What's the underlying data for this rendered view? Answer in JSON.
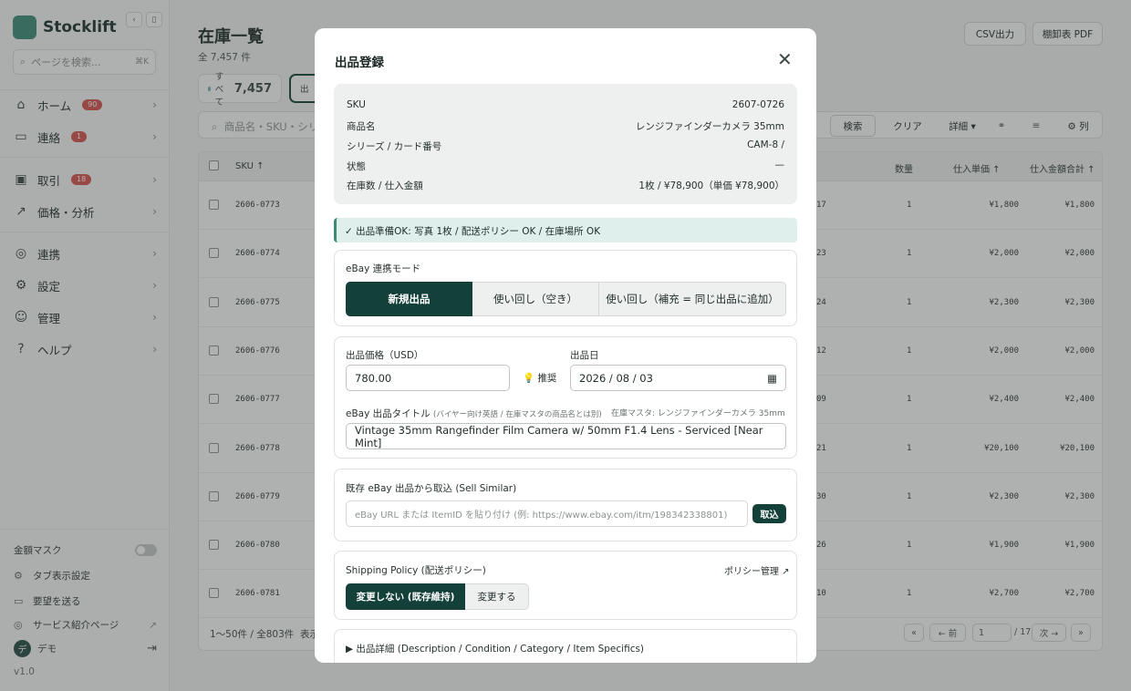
{
  "app": {
    "name": "Stocklift",
    "version": "v1.0"
  },
  "sidebar": {
    "search_placeholder": "ページを検索...",
    "search_shortcut": "⌘K",
    "items": [
      {
        "label": "ホーム",
        "badge": "90",
        "icon": "home-icon"
      },
      {
        "label": "連絡",
        "badge": "1",
        "icon": "chat-icon"
      },
      {
        "label": "取引",
        "badge": "18",
        "icon": "briefcase-icon"
      },
      {
        "label": "価格・分析",
        "badge": "",
        "icon": "trend-icon"
      },
      {
        "label": "連携",
        "badge": "",
        "icon": "globe-icon"
      },
      {
        "label": "設定",
        "badge": "",
        "icon": "gear-icon"
      },
      {
        "label": "管理",
        "badge": "",
        "icon": "users-icon"
      },
      {
        "label": "ヘルプ",
        "badge": "",
        "icon": "help-icon"
      }
    ],
    "footer": {
      "amount_mask": "金額マスク",
      "tab_settings": "タブ表示設定",
      "feedback": "要望を送る",
      "service_page": "サービス紹介ページ",
      "user": "デモ",
      "user_initial": "デ"
    }
  },
  "page": {
    "title": "在庫一覧",
    "subtitle": "全 7,457 件",
    "csv_button": "CSV出力",
    "inventory_pdf_button": "棚卸表 PDF",
    "chip_all_label": "すべて",
    "chip_all_count": "7,457",
    "chip_second": "出",
    "search_placeholder": "商品名・SKU・シリ",
    "search_button": "検索",
    "clear_button": "クリア",
    "detail_button": "詳細 ▾",
    "columns_button": "⚙ 列",
    "headers": {
      "sku": "SKU ↑",
      "qty": "数量",
      "unit_cost": "仕入単価 ↑",
      "total_cost": "仕入金額合計 ↑"
    },
    "rows": [
      {
        "sku": "2606-0773",
        "mid": "17",
        "qty": "1",
        "unit": "¥1,800",
        "total": "¥1,800"
      },
      {
        "sku": "2606-0774",
        "mid": "23",
        "qty": "1",
        "unit": "¥2,000",
        "total": "¥2,000"
      },
      {
        "sku": "2606-0775",
        "mid": "24",
        "qty": "1",
        "unit": "¥2,300",
        "total": "¥2,300"
      },
      {
        "sku": "2606-0776",
        "mid": "12",
        "qty": "1",
        "unit": "¥2,000",
        "total": "¥2,000"
      },
      {
        "sku": "2606-0777",
        "mid": "09",
        "qty": "1",
        "unit": "¥2,400",
        "total": "¥2,400"
      },
      {
        "sku": "2606-0778",
        "mid": "21",
        "qty": "1",
        "unit": "¥20,100",
        "total": "¥20,100"
      },
      {
        "sku": "2606-0779",
        "mid": "30",
        "qty": "1",
        "unit": "¥2,300",
        "total": "¥2,300"
      },
      {
        "sku": "2606-0780",
        "mid": "26",
        "qty": "1",
        "unit": "¥1,900",
        "total": "¥1,900"
      },
      {
        "sku": "2606-0781",
        "mid": "10",
        "qty": "1",
        "unit": "¥2,700",
        "total": "¥2,700"
      }
    ],
    "pager": {
      "range": "1〜50件 / 全803件",
      "display": "表示",
      "first": "«",
      "prev": "← 前",
      "page": "1",
      "of": "/ 17",
      "next": "次 →",
      "last": "»"
    }
  },
  "modal": {
    "title": "出品登録",
    "info": [
      {
        "label": "SKU",
        "value": "2607-0726"
      },
      {
        "label": "商品名",
        "value": "レンジファインダーカメラ 35mm"
      },
      {
        "label": "シリーズ / カード番号",
        "value": "CAM-8 /"
      },
      {
        "label": "状態",
        "value": "—"
      },
      {
        "label": "在庫数 / 仕入金額",
        "value": "1枚 / ¥78,900（単価 ¥78,900）"
      }
    ],
    "ok_message": "✓ 出品準備OK: 写真 1枚 / 配送ポリシー OK / 在庫場所 OK",
    "mode_label": "eBay 連携モード",
    "mode_options": [
      "新規出品",
      "使い回し（空き）",
      "使い回し（補充 = 同じ出品に追加）"
    ],
    "price_label": "出品価格（USD）",
    "price_value": "780.00",
    "suggest_label": "推奨",
    "date_label": "出品日",
    "date_value": "2026 / 08 / 03",
    "ebay_title_label": "eBay 出品タイトル",
    "ebay_title_note": "(バイヤー向け英語 / 在庫マスタの商品名とは別)",
    "master_note": "在庫マスタ: レンジファインダーカメラ 35mm",
    "ebay_title_value": "Vintage 35mm Rangefinder Film Camera w/ 50mm F1.4 Lens - Serviced [Near Mint]",
    "import_label": "既存 eBay 出品から取込 (Sell Similar)",
    "import_placeholder": "eBay URL または ItemID を貼り付け (例: https://www.ebay.com/itm/198342338801)",
    "import_button": "取込",
    "shipping_label": "Shipping Policy (配送ポリシー)",
    "policy_manage": "ポリシー管理 ↗",
    "shipping_options": [
      "変更しない (既存維持)",
      "変更する"
    ],
    "details_label": "▶ 出品詳細 (Description / Condition / Category / Item Specifics)"
  },
  "colors": {
    "accent": "#14403a",
    "brand": "#3d8a78",
    "badge": "#d9534f"
  }
}
